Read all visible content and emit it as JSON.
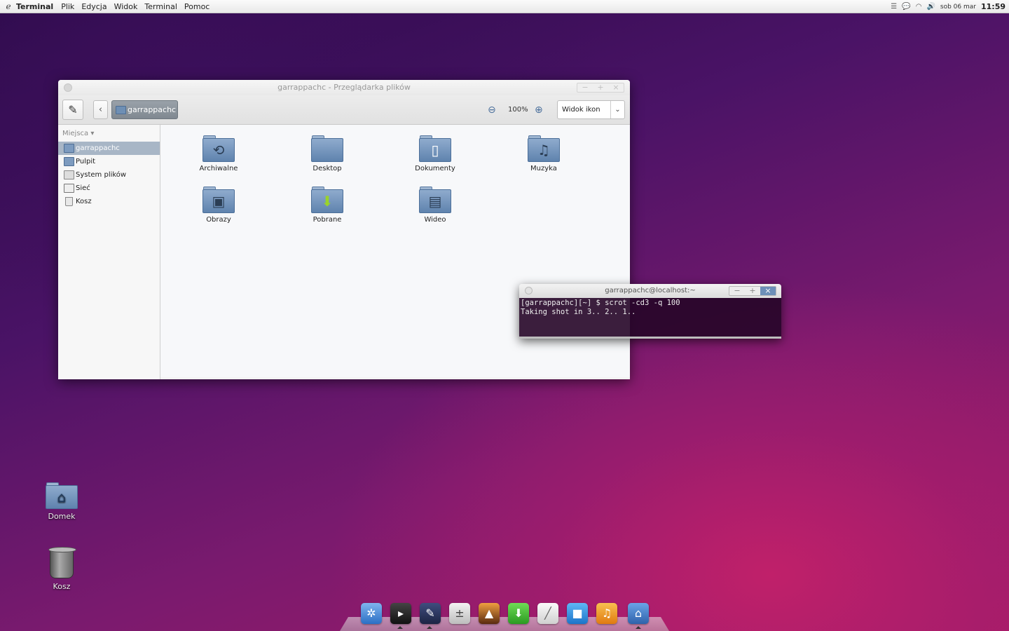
{
  "menubar": {
    "app_name": "Terminal",
    "menus": [
      "Plik",
      "Edycja",
      "Widok",
      "Terminal",
      "Pomoc"
    ],
    "date": "sob 06 mar",
    "time": "11:59"
  },
  "file_manager": {
    "title": "garrappachc - Przeglądarka plików",
    "path_button": "garrappachc",
    "zoom": "100%",
    "view_mode": "Widok ikon",
    "sidebar_heading": "Miejsca",
    "sidebar_items": [
      "garrappachc",
      "Pulpit",
      "System plików",
      "Sieć",
      "Kosz"
    ],
    "folders": [
      "Archiwalne",
      "Desktop",
      "Dokumenty",
      "Muzyka",
      "Obrazy",
      "Pobrane",
      "Wideo"
    ]
  },
  "terminal": {
    "title": "garrappachc@localhost:~",
    "line1": "[garrappachc][~] $ scrot -cd3 -q 100",
    "line2": "Taking shot in 3.. 2.. 1.."
  },
  "desktop": {
    "home_label": "Domek",
    "trash_label": "Kosz"
  },
  "dock": {
    "items": [
      "browser-icon",
      "terminal-icon",
      "editor-icon",
      "calculator-icon",
      "photos-icon",
      "download-icon",
      "notes-icon",
      "video-call-icon",
      "music-icon",
      "home-icon"
    ]
  }
}
